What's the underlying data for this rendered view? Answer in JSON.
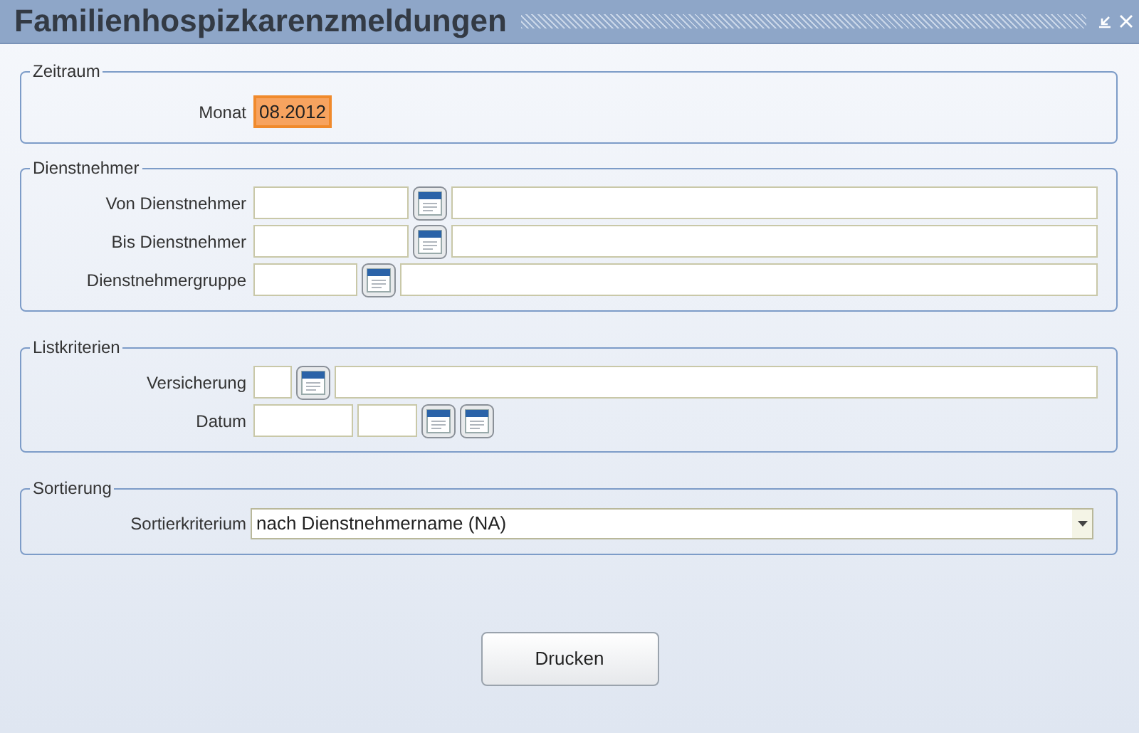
{
  "window": {
    "title": "Familienhospizkarenzmeldungen"
  },
  "sections": [
    {
      "legend": "Zeitraum",
      "rows": [
        {
          "label": "Monat",
          "controls": [
            {
              "kind": "field",
              "value": "08.2012",
              "focused": true
            }
          ]
        }
      ]
    },
    {
      "legend": "Dienstnehmer",
      "rows": [
        {
          "label": "Von Dienstnehmer",
          "controls": [
            {
              "kind": "field",
              "focused": false
            },
            {
              "kind": "lookup"
            },
            {
              "kind": "wide",
              "focused": false
            }
          ]
        },
        {
          "label": "Bis Dienstnehmer",
          "controls": [
            {
              "kind": "field",
              "focused": false
            },
            {
              "kind": "lookup"
            },
            {
              "kind": "wide",
              "focused": false
            }
          ]
        },
        {
          "label": "Dienstnehmergruppe",
          "controls": [
            {
              "kind": "field",
              "focused": false
            },
            {
              "kind": "lookup"
            },
            {
              "kind": "wide",
              "focused": false
            }
          ]
        }
      ]
    },
    {
      "legend": "Listkriterien",
      "rows": [
        {
          "label": "Versicherung",
          "controls": [
            {
              "kind": "field",
              "focused": false
            },
            {
              "kind": "lookup"
            },
            {
              "kind": "wide",
              "focused": false
            }
          ]
        },
        {
          "label": "Datum",
          "controls": [
            {
              "kind": "field",
              "focused": false
            },
            {
              "kind": "field",
              "focused": false
            },
            {
              "kind": "lookup"
            },
            {
              "kind": "lookup"
            }
          ]
        }
      ]
    },
    {
      "legend": "Sortierung",
      "rows": [
        {
          "label": "Sortierkriterium",
          "controls": [
            {
              "kind": "select",
              "value": "nach Dienstnehmername (NA)"
            }
          ]
        }
      ]
    }
  ],
  "buttons": [
    "Drucken"
  ]
}
